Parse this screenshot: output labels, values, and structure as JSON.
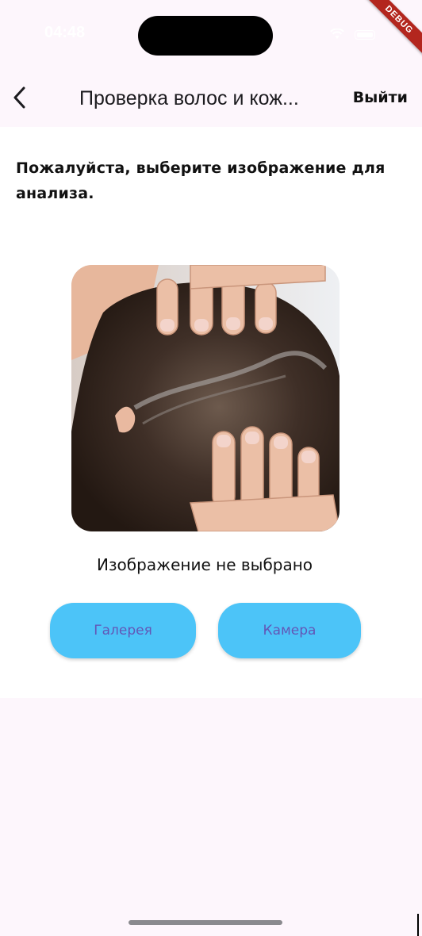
{
  "status_bar": {
    "time": "04:48",
    "icons": [
      "wifi-icon",
      "battery-icon"
    ]
  },
  "debug_banner": {
    "label": "DEBUG",
    "color": "#B3261E"
  },
  "app_bar": {
    "back_icon": "chevron-left-icon",
    "title": "Проверка волос и кож...",
    "logout_label": "Выйти"
  },
  "main": {
    "instruction": "Пожалуйста, выберите изображение для анализа.",
    "sample_image": "scalp-hair-photo",
    "no_image_text": "Изображение не выбрано",
    "gallery_label": "Галерея",
    "camera_label": "Камера"
  },
  "colors": {
    "background": "#FDF6FC",
    "content": "#FFFFFF",
    "button": "#4CC4F8",
    "button_text": "#6257B7"
  }
}
